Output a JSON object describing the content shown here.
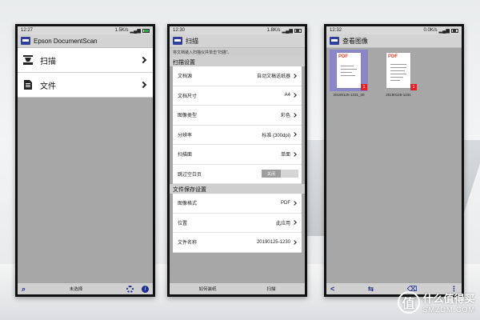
{
  "phone1": {
    "status": {
      "time": "12:27",
      "speed": "1.5K/s"
    },
    "app_title": "Epson DocumentScan",
    "menu": [
      {
        "label": "扫描",
        "icon": "scanner-icon"
      },
      {
        "label": "文件",
        "icon": "document-icon"
      }
    ],
    "bottom": {
      "center_label": "未选择"
    }
  },
  "phone2": {
    "status": {
      "time": "12:30",
      "speed": "1.8K/s"
    },
    "title": "扫描",
    "hint": "将文档装入扫描仪并单击\"扫描\"。",
    "scan_section": "扫描设置",
    "scan_settings": [
      {
        "key": "文档源",
        "value": "自动文稿送纸器"
      },
      {
        "key": "文档尺寸",
        "value": "A4"
      },
      {
        "key": "图像类型",
        "value": "彩色"
      },
      {
        "key": "分辨率",
        "value": "标准 (300dpi)"
      },
      {
        "key": "扫描面",
        "value": "单面"
      }
    ],
    "skip_blank": {
      "key": "跳过空白页",
      "toggle": "关闭"
    },
    "save_section": "文件保存设置",
    "save_settings": [
      {
        "key": "图像格式",
        "value": "PDF"
      },
      {
        "key": "位置",
        "value": "此应用"
      },
      {
        "key": "文件名称",
        "value": "20190125-1230"
      }
    ],
    "bottom": {
      "left": "如何装纸",
      "right": "扫描"
    }
  },
  "phone3": {
    "status": {
      "time": "12:32",
      "speed": "0.0K/s"
    },
    "title": "查看图像",
    "thumbnails": [
      {
        "name": "20190125-1231_00",
        "badge": "1",
        "tag": "PDF",
        "selected": true
      },
      {
        "name": "20190125-1231",
        "badge": "1",
        "tag": "PDF",
        "selected": false
      }
    ]
  },
  "watermark": {
    "glyph": "值",
    "cn": "什么值得买",
    "en": "SMZDM.COM"
  },
  "colors": {
    "accent": "#1d2f8c",
    "badge": "#e0202a",
    "selection": "#8b86c7",
    "pdf": "#e04b3a"
  }
}
